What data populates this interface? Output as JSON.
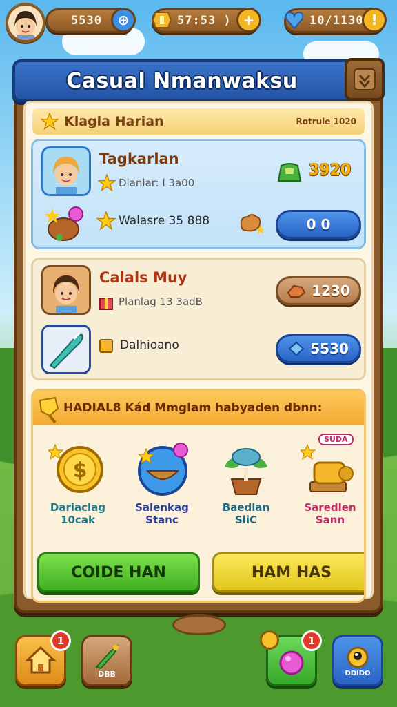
{
  "topbar": {
    "coins": "5530",
    "energy": "57:53 )",
    "hearts": "10/1130"
  },
  "panel": {
    "title": "Casual Nmanwaksu"
  },
  "daily": {
    "heading": "Klagla Harian",
    "tag": "Rotrule 1020"
  },
  "card1": {
    "title": "Tagkarlan",
    "subtitle": "Dlanlar: l 3a00",
    "reward": "3920",
    "row2_text": "Walasre 35 888",
    "button": "0 0"
  },
  "card2": {
    "title": "Calals Muy",
    "subtitle": "Planlag 13 3adB",
    "reward": "1230",
    "row2_text": "Dalhioano",
    "button": "5530"
  },
  "rewards": {
    "heading": "HADIAL8 Kád Mmglam habyaden dbnn:",
    "items": [
      {
        "line1": "Dariaclag",
        "line2": "10cak",
        "color": "#1c7a8a"
      },
      {
        "line1": "Salenkag",
        "line2": "Stanc",
        "color": "#2d3f9a"
      },
      {
        "line1": "Baedlan",
        "line2": "SliC",
        "color": "#1d6a8a"
      },
      {
        "line1": "Saredlen",
        "line2": "Sann",
        "color": "#c42a6a"
      }
    ],
    "reward4_tag": "SUDA",
    "btn_green": "COIDE HAN",
    "btn_yellow": "HAM HAS"
  },
  "nav": {
    "home_badge": "1",
    "shop_label": "DBB",
    "gem_badge": "1",
    "profile_label": "DDIDO"
  }
}
